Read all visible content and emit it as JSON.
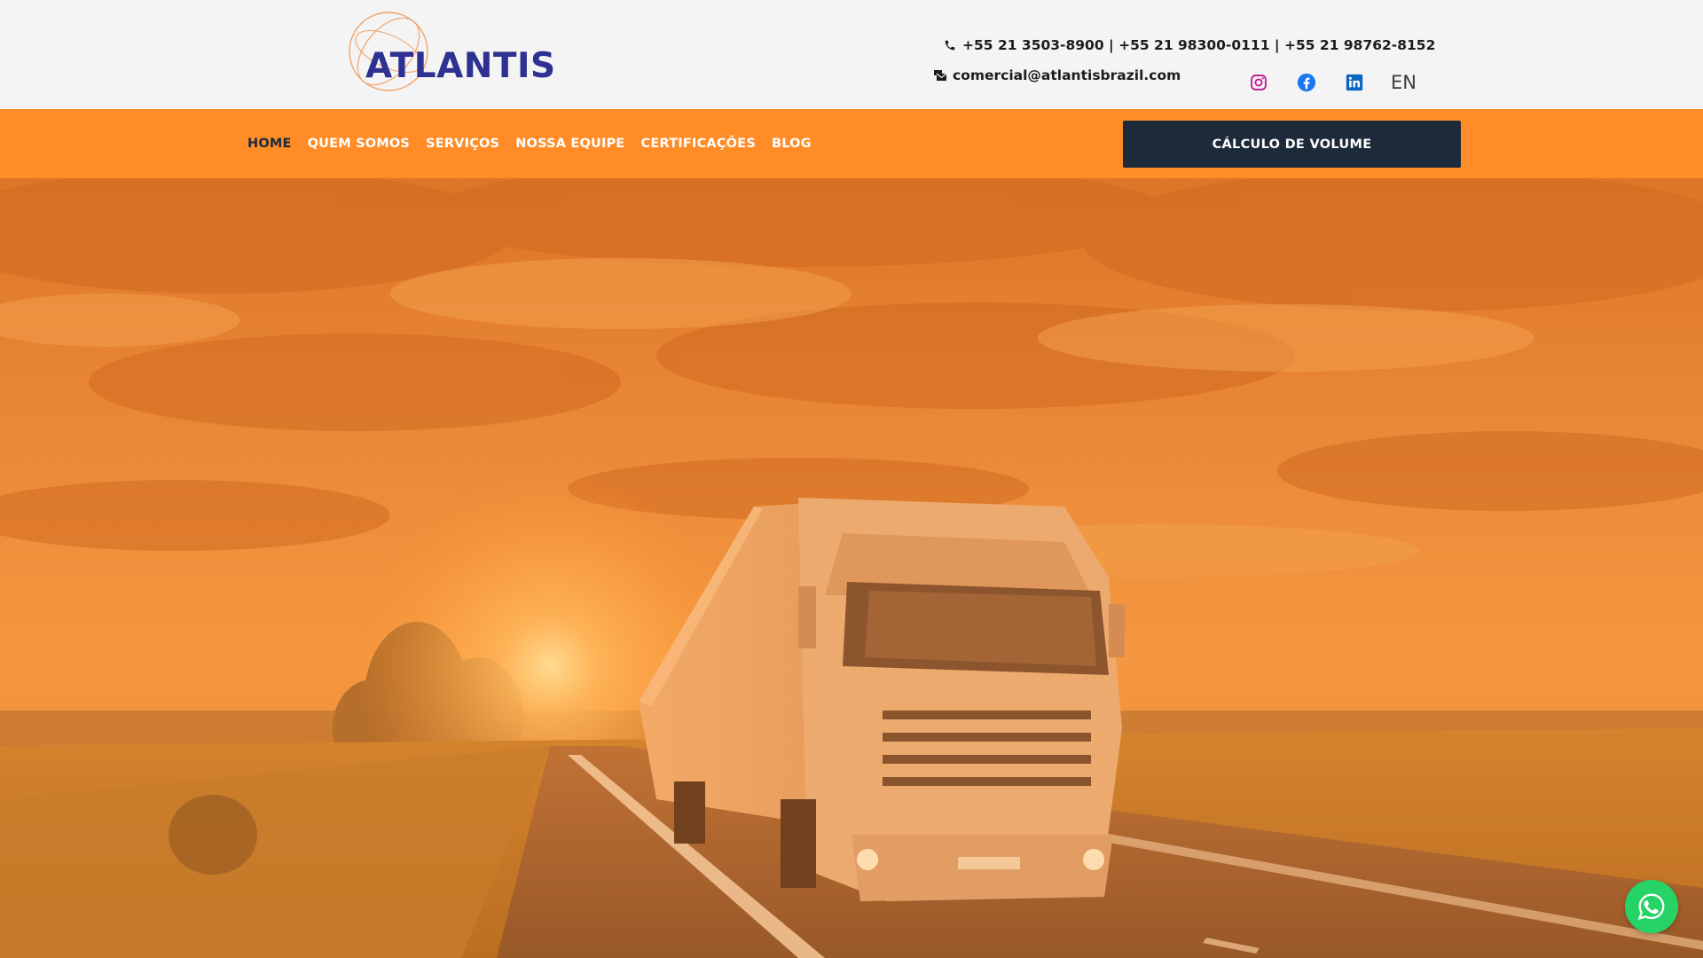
{
  "brand": {
    "name": "ATLANTIS",
    "color": "#2e3192",
    "ring_color": "#f0a46a"
  },
  "contact": {
    "phone_icon": "phone-icon",
    "phones": "+55 21 3503-8900 | +55 21 98300-0111 | +55 21 98762-8152",
    "email_icon": "mail-bulk-icon",
    "email": "comercial@atlantisbrazil.com"
  },
  "social": [
    {
      "name": "instagram-icon",
      "color": "#c2188f"
    },
    {
      "name": "facebook-icon",
      "color": "#1877f2"
    },
    {
      "name": "linkedin-icon",
      "color": "#0a66c2"
    }
  ],
  "language": "EN",
  "nav": {
    "items": [
      {
        "label": "HOME",
        "active": true
      },
      {
        "label": "QUEM SOMOS",
        "active": false
      },
      {
        "label": "SERVIÇOS",
        "active": false
      },
      {
        "label": "NOSSA EQUIPE",
        "active": false
      },
      {
        "label": "CERTIFICAÇÕES",
        "active": false
      },
      {
        "label": "BLOG",
        "active": false
      }
    ],
    "cta_label": "CÁLCULO DE VOLUME",
    "bar_color": "#ff8c26",
    "cta_color": "#1c2a3a"
  },
  "hero": {
    "image": "truck-on-highway-at-sunset",
    "overlay_color": "#ff8c26"
  },
  "whatsapp": {
    "icon": "whatsapp-icon",
    "color": "#25d366"
  }
}
